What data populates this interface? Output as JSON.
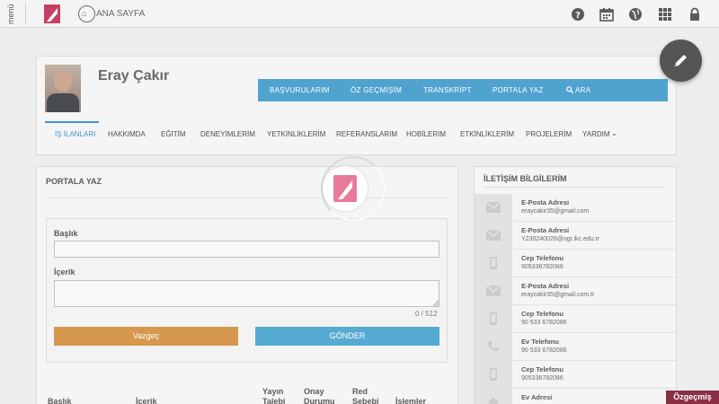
{
  "topbar": {
    "menu_label": "menü",
    "home_label": "ANA SAYFA",
    "icons": [
      "help-icon",
      "calendar-icon",
      "globe-icon",
      "apps-grid-icon",
      "lock-icon"
    ]
  },
  "profile": {
    "name": "Eray Çakır",
    "nav": [
      "BAŞVURULARIM",
      "ÖZ GEÇMİŞİM",
      "TRANSKRİPT",
      "PORTALA YAZ",
      "ARA"
    ],
    "tabs": [
      "İŞ İLANLARI",
      "HAKKIMDA",
      "EĞİTİM",
      "DENEYİMLERİM",
      "YETKİNLİKLERİM",
      "REFERANSLARIM",
      "HOBİLERİM",
      "ETKİNLİKLERİM",
      "PROJELERİM",
      "YARDIM"
    ],
    "active_tab": "İŞ İLANLARI"
  },
  "portal": {
    "title": "PORTALA YAZ",
    "title_label": "Başlık",
    "content_label": "İçerik",
    "counter": "0 / 512",
    "cancel_label": "Vazgeç",
    "send_label": "GÖNDER",
    "table_headers": [
      "Başlık",
      "İçerik",
      "Yayın Talebi",
      "Onay Durumu",
      "Red Sebebi",
      "İşlemler"
    ]
  },
  "contact": {
    "title": "İLETİŞİM BİLGİLERİM",
    "items": [
      {
        "type": "email",
        "title": "E-Posta Adresi",
        "value": "eraycakir35@gmail.com"
      },
      {
        "type": "email",
        "title": "E-Posta Adresi",
        "value": "Y230240026@ogr.ikc.edu.tr"
      },
      {
        "type": "mobile",
        "title": "Cep Telefonu",
        "value": "905336782086"
      },
      {
        "type": "email",
        "title": "E-Posta Adresi",
        "value": "eraycakir35@gmail.com.tr"
      },
      {
        "type": "mobile",
        "title": "Cep Telefonu",
        "value": "90 533 6782086"
      },
      {
        "type": "phone",
        "title": "Ev Telefonu",
        "value": "90 533 6782086"
      },
      {
        "type": "mobile",
        "title": "Cep Telefonu",
        "value": "905336782086"
      },
      {
        "type": "home",
        "title": "Ev Adresi",
        "value": ""
      }
    ]
  },
  "footer_badge": "Özgeçmiş",
  "colors": {
    "nav_blue": "#3a97c9",
    "cancel_orange": "#d08a35",
    "send_blue": "#3fa0cc",
    "brand_maroon": "#8a2f46",
    "logo_pink": "#e87a9a"
  }
}
